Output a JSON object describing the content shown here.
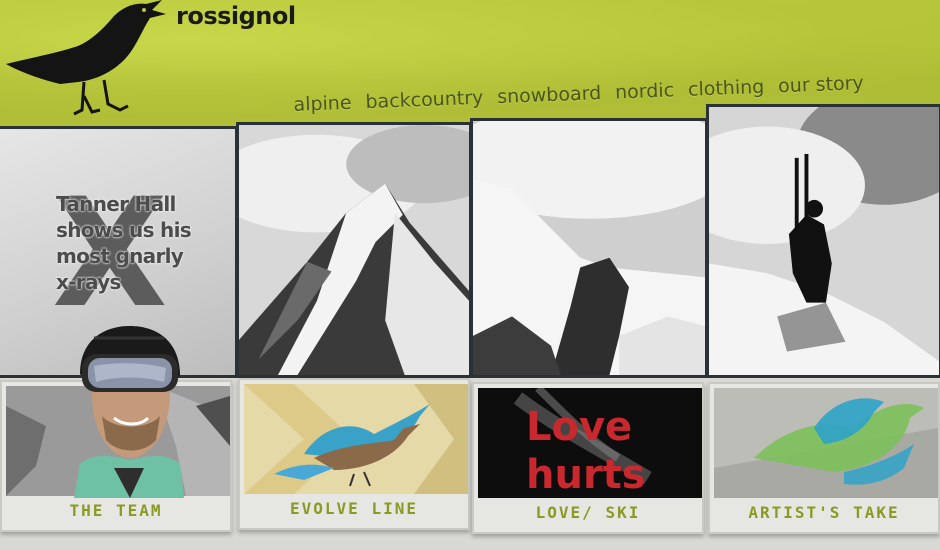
{
  "header": {
    "brand": "rossignol",
    "logo_icon": "bird-logo-icon"
  },
  "nav": {
    "items": [
      {
        "label": "alpine"
      },
      {
        "label": "backcountry"
      },
      {
        "label": "snowboard"
      },
      {
        "label": "nordic"
      },
      {
        "label": "clothing"
      },
      {
        "label": "our story"
      }
    ]
  },
  "hero": {
    "teaser_mark": "X",
    "teaser_lines": [
      "Tanner Hall",
      "shows us his",
      "most gnarly",
      "x-rays"
    ]
  },
  "cards": [
    {
      "label": "THE TEAM"
    },
    {
      "label": "EVOLVE LINE"
    },
    {
      "label": "LOVE/ SKI",
      "thumb_text": [
        "Love",
        "hurts"
      ]
    },
    {
      "label": "ARTIST'S TAKE"
    }
  ],
  "colors": {
    "header_bg": "#b6c43a",
    "nav_text": "#4a561a",
    "card_label": "#8a9a22",
    "panel_border": "#2a3238",
    "love_red": "#c8282e"
  }
}
